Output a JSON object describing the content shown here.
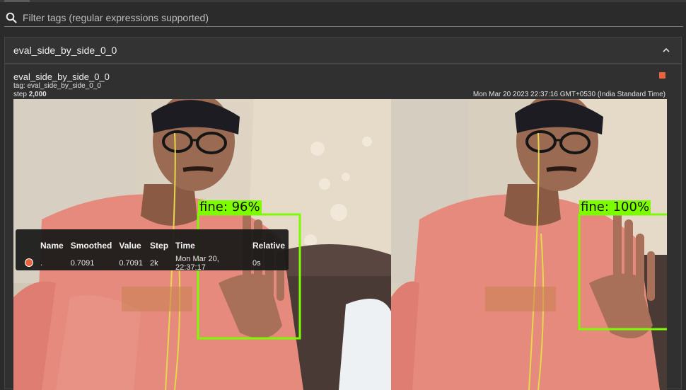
{
  "filter": {
    "placeholder": "Filter tags (regular expressions supported)",
    "icon": "search-icon"
  },
  "group": {
    "title": "eval_side_by_side_0_0",
    "chevron": "chevron-up-icon"
  },
  "card": {
    "title": "eval_side_by_side_0_0",
    "tag_line": "tag: eval_side_by_side_0_0",
    "step_prefix": "step ",
    "step_value": "2,000",
    "timestamp": "Mon Mar 20 2023 22:37:16 GMT+0530 (India Standard Time)",
    "run_color": "#e8643c"
  },
  "detections": {
    "left_label": "fine: 96%",
    "right_label": "fine: 100%",
    "box_color": "#7cfc00"
  },
  "tooltip": {
    "headers": [
      "",
      "Name",
      "Smoothed",
      "Value",
      "Step",
      "Time",
      "Relative"
    ],
    "row": {
      "name": ".",
      "smoothed": "0.7091",
      "value": "0.7091",
      "step": "2k",
      "time": "Mon Mar 20, 22:37:17",
      "relative": "0s"
    }
  }
}
